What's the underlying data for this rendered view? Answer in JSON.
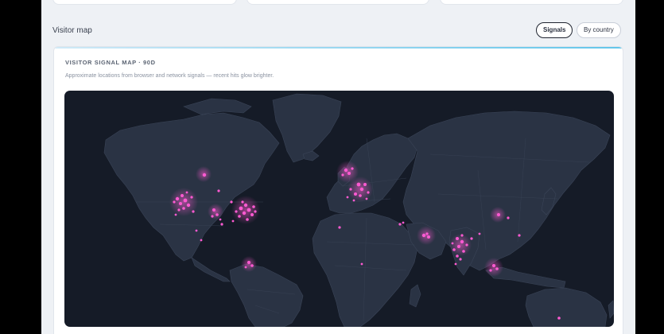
{
  "section": {
    "title": "Visitor map"
  },
  "toggles": [
    {
      "label": "Signals",
      "active": true
    },
    {
      "label": "By country",
      "active": false
    }
  ],
  "card": {
    "title": "VISITOR SIGNAL MAP · 90D",
    "description": "Approximate locations from browser and network signals — recent hits glow brighter."
  },
  "colors": {
    "map_background": "#151b27",
    "land": "#2a3344",
    "borders": "#3a4457",
    "signal": "#ff5ad2",
    "accent": "#63c6ea"
  }
}
